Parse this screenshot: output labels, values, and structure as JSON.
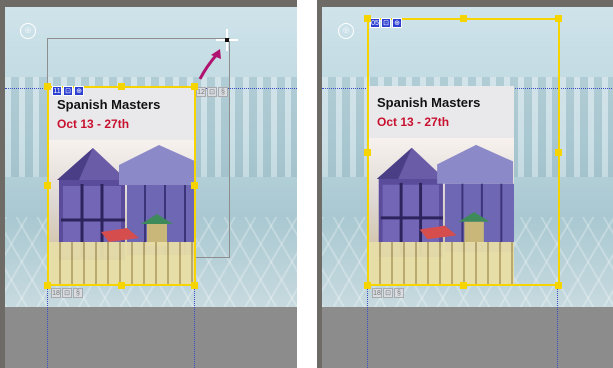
{
  "panels": [
    {
      "poster": {
        "title": "Spanish Masters",
        "dates": "Oct 13 - 27th"
      },
      "badge_icons": [
        "frame-number-icon",
        "link-icon",
        "chain-icon"
      ],
      "badge_label": "11"
    },
    {
      "poster": {
        "title": "Spanish Masters",
        "dates": "Oct 13 - 27th"
      },
      "badge_icons": [
        "frame-number-icon",
        "link-icon",
        "chain-icon"
      ],
      "badge_label": "05"
    }
  ],
  "colors": {
    "selection_frame": "#f5d400",
    "guide_line": "#3b4cc8",
    "drag_arrow": "#b0126f",
    "date_text": "#c8102e",
    "canvas_gray": "#8c8c8c"
  }
}
